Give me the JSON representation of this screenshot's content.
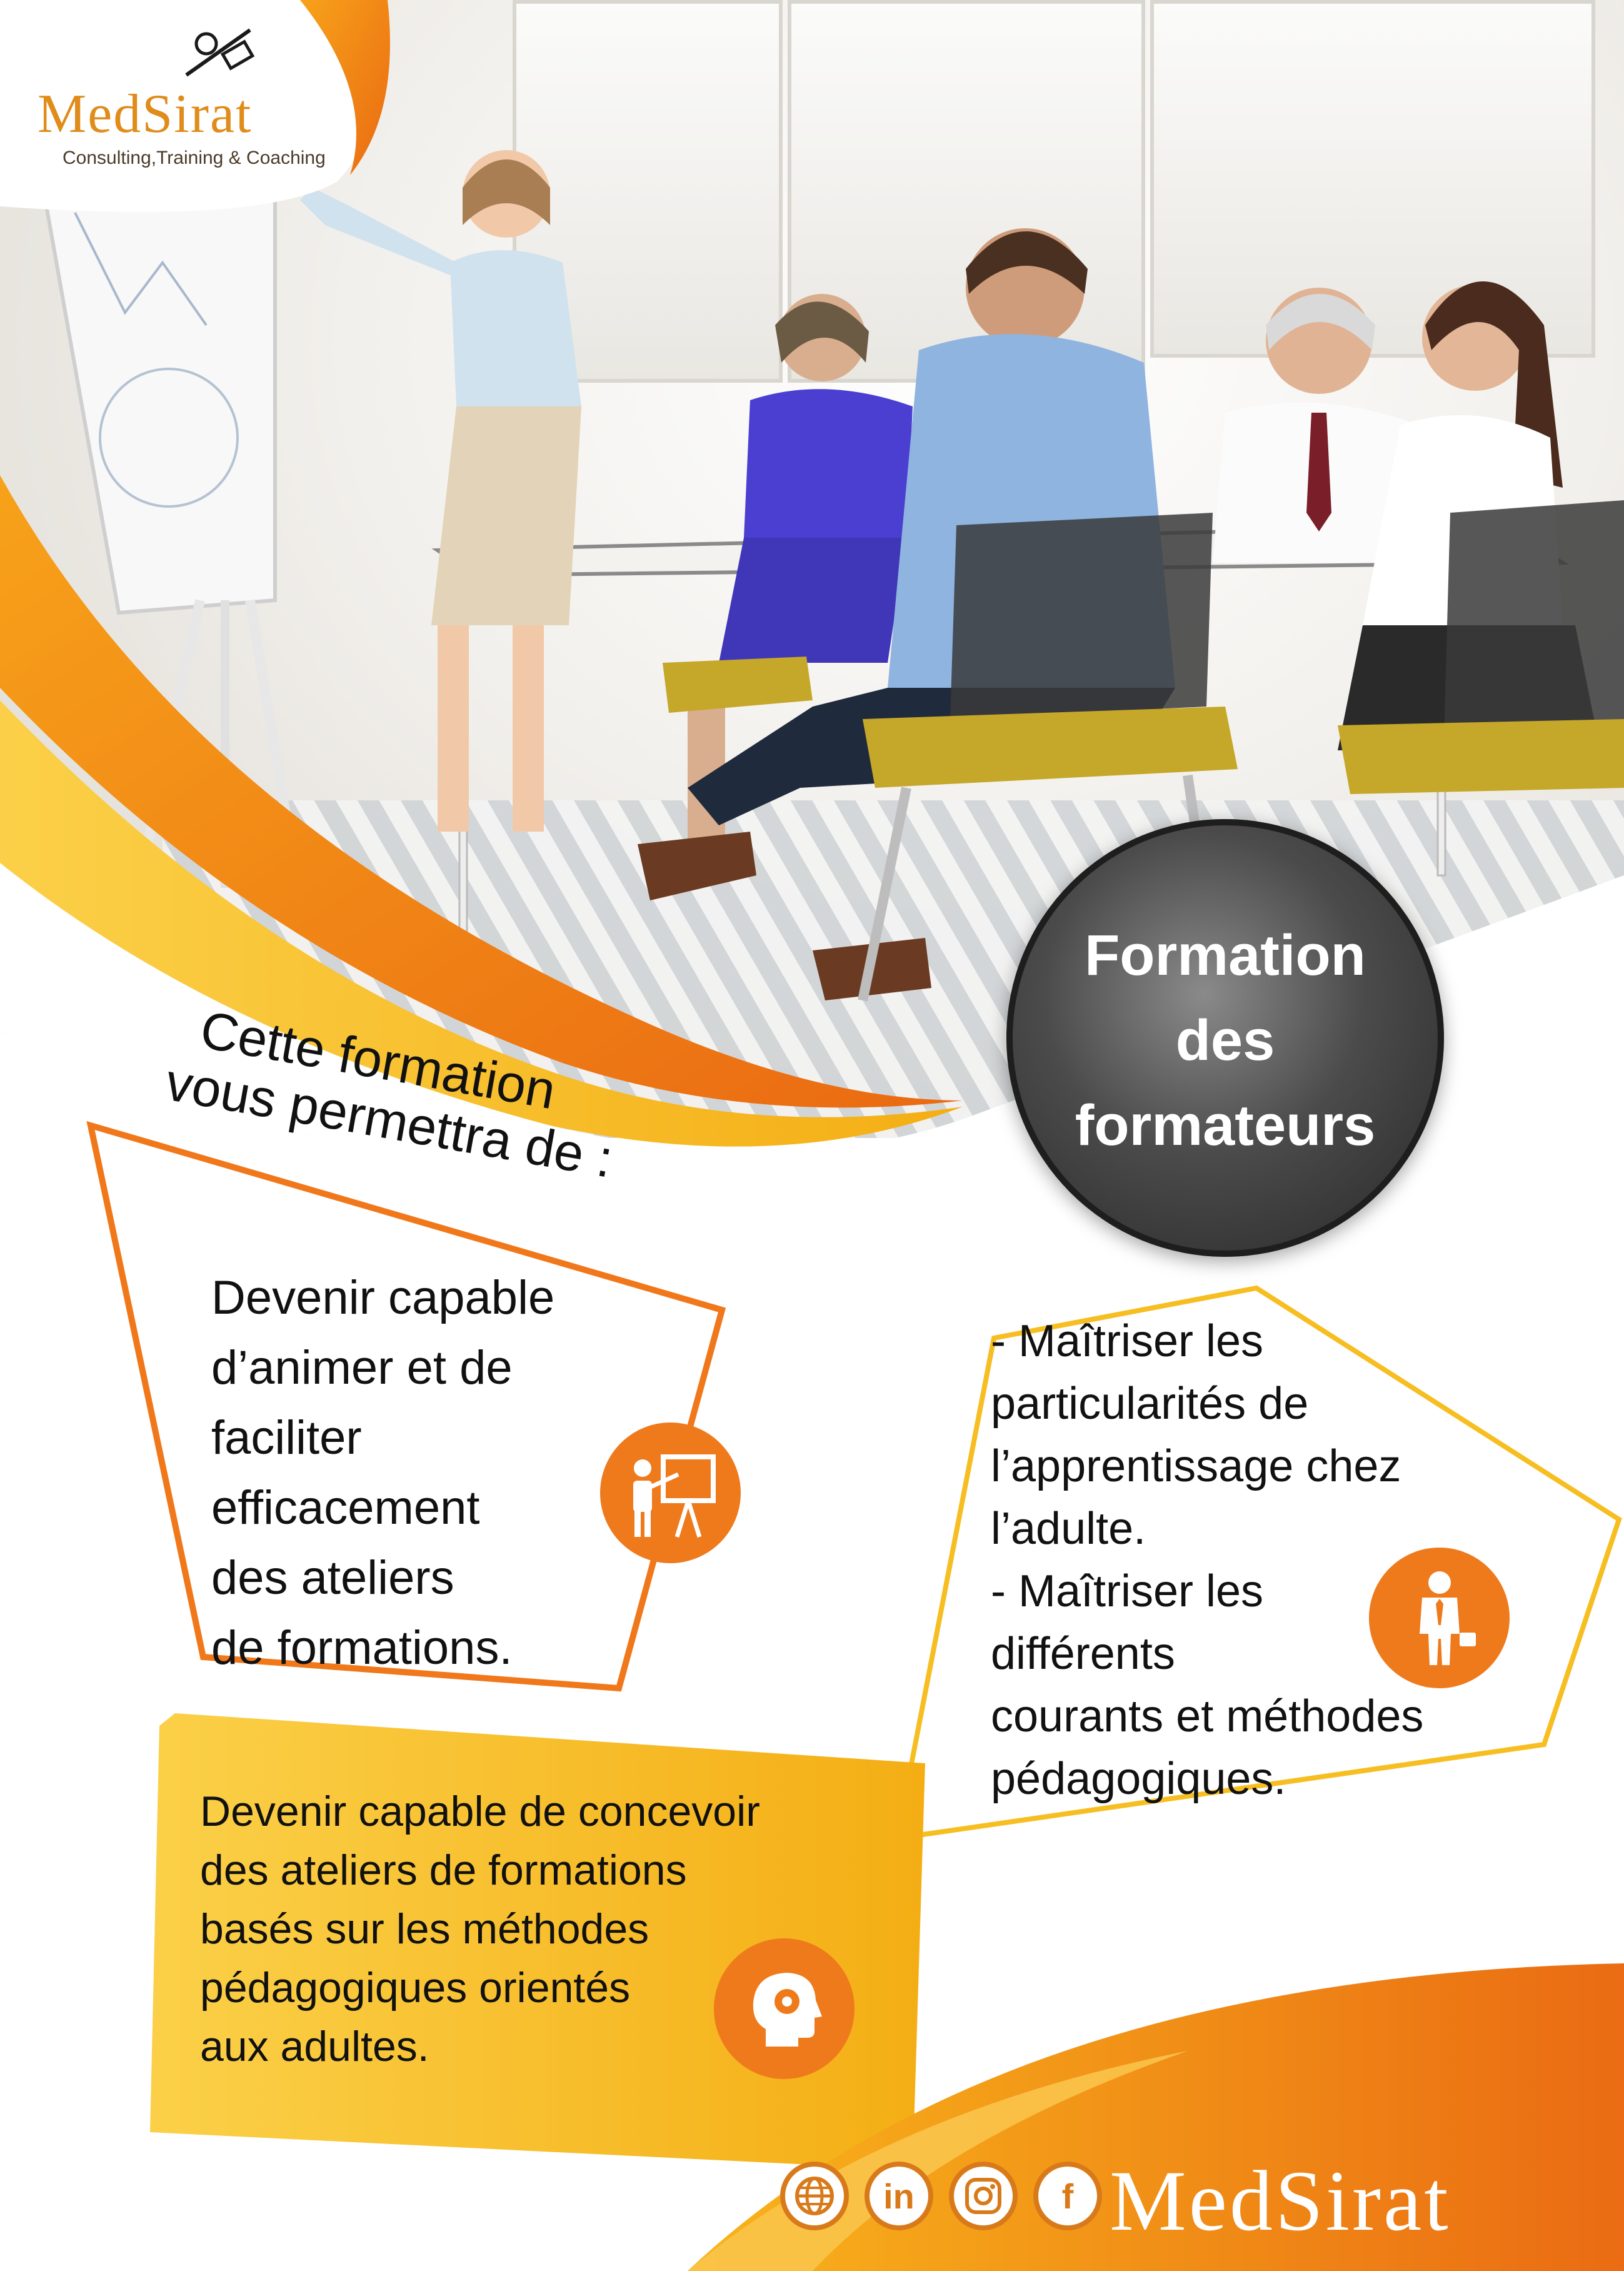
{
  "brand": {
    "logo_word": "MEDSIRAT",
    "logo_word_display": "MedSirat",
    "tagline": "Consulting,Training & Coaching",
    "footer_word": "MedSirat"
  },
  "title": {
    "line1": "Formation",
    "line2": "des",
    "line3": "formateurs"
  },
  "intro": {
    "line1": "Cette formation",
    "line2": "vous permettra de :"
  },
  "block1": {
    "lines": [
      "Devenir capable",
      "d’animer et de",
      "faciliter",
      "efficacement",
      "des ateliers",
      " de formations."
    ]
  },
  "block2": {
    "lines": [
      "- Maîtriser les",
      "particularités de",
      "l’apprentissage chez",
      "l’adulte.",
      "- Maîtriser les",
      " différents",
      " courants et méthodes",
      " pédagogiques."
    ]
  },
  "block3": {
    "lines": [
      "Devenir capable de concevoir",
      "des ateliers de formations",
      "basés sur les méthodes",
      "pédagogiques orientés",
      "aux adultes."
    ]
  },
  "social": {
    "web": "web-globe-icon",
    "linkedin": "in",
    "instagram": "instagram-icon",
    "facebook": "f"
  },
  "colors": {
    "orange": "#ee7a1c",
    "amber": "#f7b21a",
    "yellow": "#f9c12e",
    "badge_dark": "#2b2b2b"
  },
  "icons": [
    "presenter-board-icon",
    "businessman-icon",
    "head-gear-icon"
  ]
}
